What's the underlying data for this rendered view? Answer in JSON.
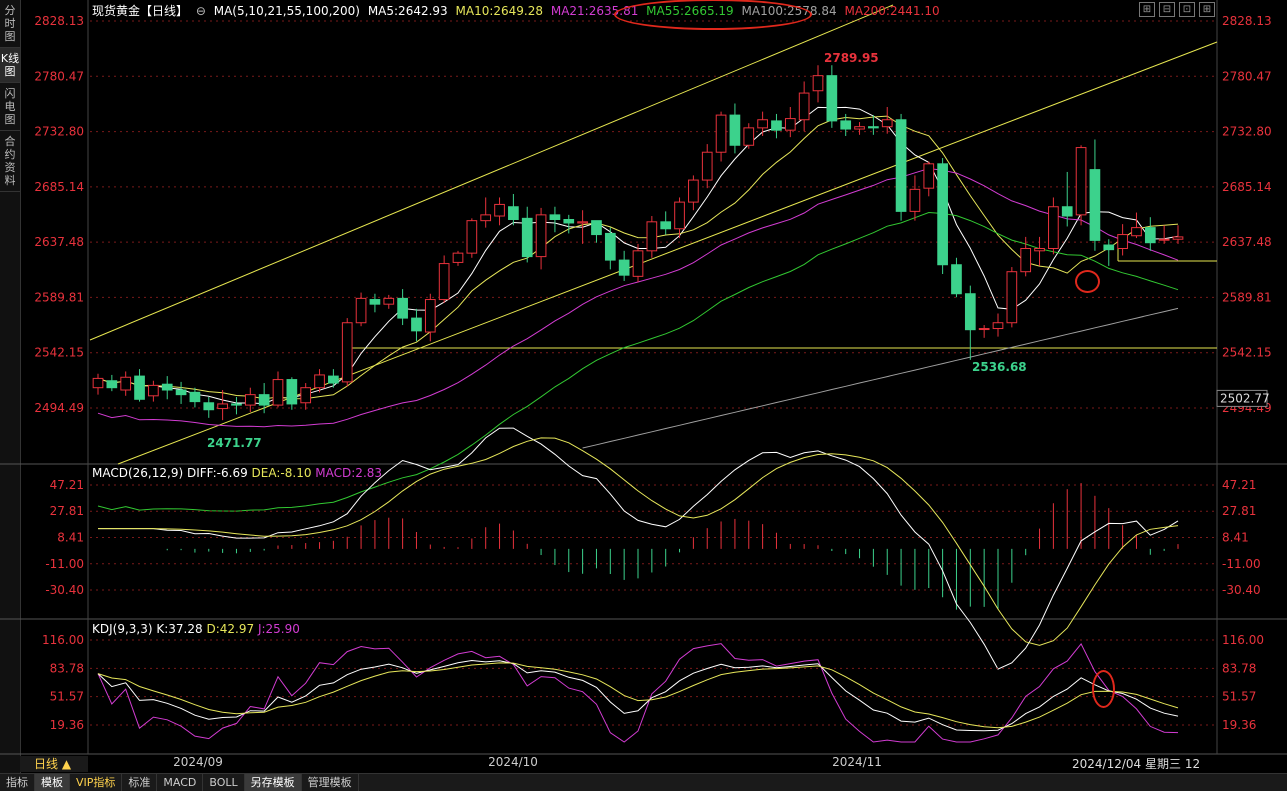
{
  "leftbar": {
    "items": [
      {
        "label": "分时图",
        "active": false
      },
      {
        "label": "K线图",
        "active": true
      },
      {
        "label": "闪电图",
        "active": false
      },
      {
        "label": "合约资料",
        "active": false
      }
    ]
  },
  "header": {
    "title": "现货黄金【日线】",
    "ma_label": "MA(5,10,21,55,100,200)",
    "ma5": "MA5:2642.93",
    "ma10": "MA10:2649.28",
    "ma21": "MA21:2635.81",
    "ma55": "MA55:2665.19",
    "ma100": "MA100:2578.84",
    "ma200": "MA200:2441.10"
  },
  "macd_header": {
    "label": "MACD(26,12,9)",
    "diff": "DIFF:-6.69",
    "dea": "DEA:-8.10",
    "macd": "MACD:2.83"
  },
  "kdj_header": {
    "label": "KDJ(9,3,3)",
    "k": "K:37.28",
    "d": "D:42.97",
    "j": "J:25.90"
  },
  "period": "日线 ▲",
  "current_date": "2024/12/04 星期三",
  "current_date_suffix": "12",
  "bottom_tabs": [
    {
      "label": "指标",
      "active": false
    },
    {
      "label": "模板",
      "active": true
    },
    {
      "label": "VIP指标",
      "active": false
    },
    {
      "label": "标准",
      "active": false
    },
    {
      "label": "MACD",
      "active": false
    },
    {
      "label": "BOLL",
      "active": false
    },
    {
      "label": "另存模板",
      "active": true
    },
    {
      "label": "管理模板",
      "active": false
    }
  ],
  "colors": {
    "up": "#e8323c",
    "down": "#3cd28c",
    "ma5": "#ffffff",
    "ma10": "#e6e65a",
    "ma21": "#d23cd2",
    "ma55": "#32c832",
    "ma100": "#a0a0a0",
    "ma200": "#e8323c",
    "grid": "#7a1a1a",
    "axis_text": "#e8323c",
    "trend": "#e6e650"
  },
  "chart_data": {
    "type": "candlestick",
    "price_axis": {
      "ticks": [
        2828.13,
        2780.47,
        2732.8,
        2685.14,
        2637.48,
        2589.81,
        2542.15,
        2494.49
      ],
      "current": 2502.77
    },
    "x_labels": [
      "2024/09",
      "2024/10",
      "2024/11"
    ],
    "annotations": {
      "high": 2789.95,
      "low1": 2471.77,
      "low2": 2536.68
    },
    "candles": [
      [
        2512,
        2520,
        2506,
        2524
      ],
      [
        2518,
        2512,
        2509,
        2523
      ],
      [
        2510,
        2521,
        2505,
        2526
      ],
      [
        2522,
        2502,
        2500,
        2528
      ],
      [
        2505,
        2514,
        2500,
        2518
      ],
      [
        2515,
        2510,
        2502,
        2522
      ],
      [
        2510,
        2506,
        2498,
        2517
      ],
      [
        2508,
        2500,
        2495,
        2512
      ],
      [
        2499,
        2493,
        2486,
        2504
      ],
      [
        2494,
        2498,
        2484,
        2510
      ],
      [
        2498,
        2497,
        2489,
        2504
      ],
      [
        2497,
        2506,
        2491,
        2512
      ],
      [
        2506,
        2497,
        2490,
        2516
      ],
      [
        2497,
        2519,
        2495,
        2526
      ],
      [
        2519,
        2498,
        2493,
        2521
      ],
      [
        2499,
        2512,
        2493,
        2516
      ],
      [
        2512,
        2523,
        2508,
        2528
      ],
      [
        2522,
        2516,
        2512,
        2528
      ],
      [
        2517,
        2568,
        2513,
        2572
      ],
      [
        2568,
        2589,
        2565,
        2594
      ],
      [
        2588,
        2584,
        2577,
        2593
      ],
      [
        2584,
        2589,
        2580,
        2592
      ],
      [
        2589,
        2572,
        2566,
        2597
      ],
      [
        2572,
        2561,
        2552,
        2580
      ],
      [
        2560,
        2588,
        2552,
        2593
      ],
      [
        2588,
        2619,
        2585,
        2626
      ],
      [
        2620,
        2628,
        2617,
        2630
      ],
      [
        2628,
        2656,
        2624,
        2658
      ],
      [
        2656,
        2661,
        2650,
        2676
      ],
      [
        2660,
        2670,
        2652,
        2676
      ],
      [
        2668,
        2657,
        2652,
        2679
      ],
      [
        2658,
        2625,
        2620,
        2668
      ],
      [
        2625,
        2661,
        2614,
        2667
      ],
      [
        2661,
        2657,
        2646,
        2668
      ],
      [
        2657,
        2654,
        2645,
        2661
      ],
      [
        2654,
        2655,
        2636,
        2665
      ],
      [
        2656,
        2644,
        2637,
        2650
      ],
      [
        2645,
        2622,
        2614,
        2650
      ],
      [
        2622,
        2609,
        2604,
        2630
      ],
      [
        2608,
        2630,
        2603,
        2636
      ],
      [
        2630,
        2655,
        2624,
        2660
      ],
      [
        2655,
        2649,
        2644,
        2664
      ],
      [
        2649,
        2672,
        2641,
        2676
      ],
      [
        2672,
        2691,
        2665,
        2695
      ],
      [
        2691,
        2715,
        2684,
        2722
      ],
      [
        2715,
        2747,
        2707,
        2750
      ],
      [
        2747,
        2721,
        2714,
        2757
      ],
      [
        2721,
        2736,
        2718,
        2740
      ],
      [
        2736,
        2743,
        2729,
        2750
      ],
      [
        2742,
        2734,
        2727,
        2748
      ],
      [
        2734,
        2744,
        2728,
        2754
      ],
      [
        2743,
        2766,
        2733,
        2776
      ],
      [
        2768,
        2781,
        2758,
        2790
      ],
      [
        2781,
        2742,
        2736,
        2790
      ],
      [
        2742,
        2735,
        2729,
        2748
      ],
      [
        2735,
        2737,
        2730,
        2741
      ],
      [
        2737,
        2736,
        2730,
        2747
      ],
      [
        2737,
        2743,
        2731,
        2754
      ],
      [
        2743,
        2664,
        2656,
        2748
      ],
      [
        2664,
        2683,
        2656,
        2695
      ],
      [
        2684,
        2705,
        2677,
        2707
      ],
      [
        2705,
        2618,
        2610,
        2710
      ],
      [
        2618,
        2593,
        2590,
        2624
      ],
      [
        2593,
        2562,
        2536,
        2600
      ],
      [
        2563,
        2563,
        2555,
        2566
      ],
      [
        2563,
        2568,
        2556,
        2576
      ],
      [
        2568,
        2612,
        2564,
        2616
      ],
      [
        2612,
        2632,
        2608,
        2642
      ],
      [
        2630,
        2632,
        2617,
        2642
      ],
      [
        2632,
        2668,
        2627,
        2676
      ],
      [
        2668,
        2660,
        2651,
        2698
      ],
      [
        2661,
        2719,
        2652,
        2721
      ],
      [
        2700,
        2639,
        2630,
        2726
      ],
      [
        2635,
        2631,
        2617,
        2640
      ],
      [
        2632,
        2644,
        2626,
        2653
      ],
      [
        2643,
        2650,
        2641,
        2663
      ],
      [
        2650,
        2637,
        2630,
        2659
      ],
      [
        2640,
        2640,
        2636,
        2652
      ],
      [
        2640,
        2642,
        2636,
        2652
      ]
    ],
    "macd_axis": {
      "ticks": [
        47.21,
        27.81,
        8.41,
        -11.0,
        -30.4
      ]
    },
    "kdj_axis": {
      "ticks": [
        116.0,
        83.78,
        51.57,
        19.36
      ]
    }
  }
}
